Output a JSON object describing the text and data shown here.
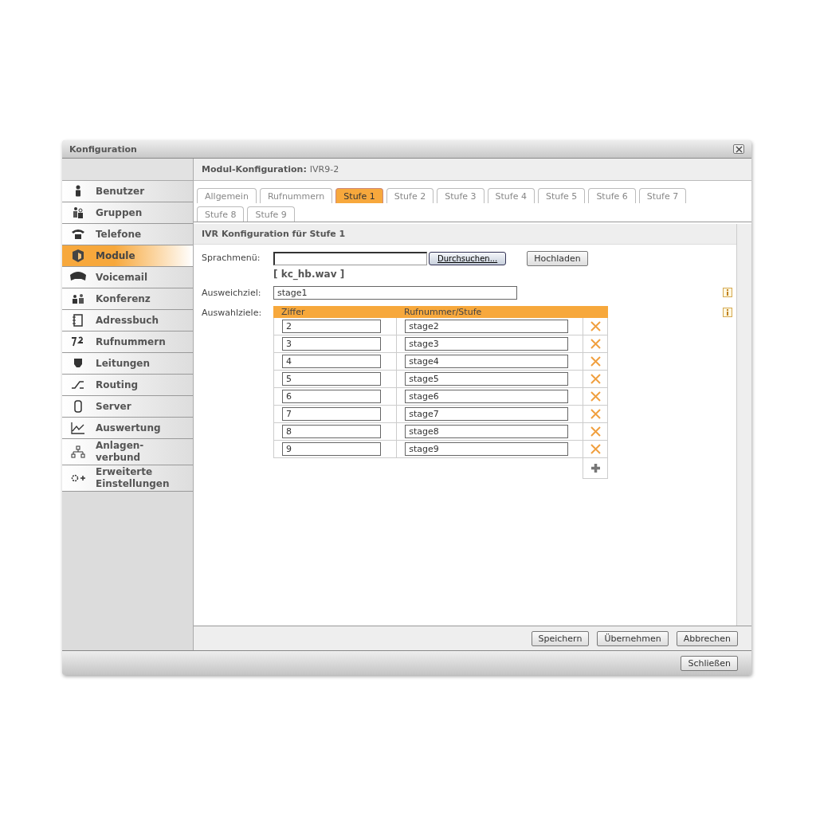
{
  "window": {
    "title": "Konfiguration"
  },
  "sidebar": {
    "items": [
      {
        "label": "Benutzer",
        "selected": false
      },
      {
        "label": "Gruppen",
        "selected": false
      },
      {
        "label": "Telefone",
        "selected": false
      },
      {
        "label": "Module",
        "selected": true
      },
      {
        "label": "Voicemail",
        "selected": false
      },
      {
        "label": "Konferenz",
        "selected": false
      },
      {
        "label": "Adressbuch",
        "selected": false
      },
      {
        "label": "Rufnummern",
        "selected": false
      },
      {
        "label": "Leitungen",
        "selected": false
      },
      {
        "label": "Routing",
        "selected": false
      },
      {
        "label": "Server",
        "selected": false
      },
      {
        "label": "Auswertung",
        "selected": false
      },
      {
        "label": "Anlagen-\nverbund",
        "selected": false
      },
      {
        "label": "Erweiterte\nEinstellungen",
        "selected": false
      }
    ]
  },
  "header": {
    "label": "Modul-Konfiguration:",
    "value": "IVR9-2"
  },
  "tabs": [
    {
      "label": "Allgemein",
      "selected": false
    },
    {
      "label": "Rufnummern",
      "selected": false
    },
    {
      "label": "Stufe 1",
      "selected": true
    },
    {
      "label": "Stufe 2",
      "selected": false
    },
    {
      "label": "Stufe 3",
      "selected": false
    },
    {
      "label": "Stufe 4",
      "selected": false
    },
    {
      "label": "Stufe 5",
      "selected": false
    },
    {
      "label": "Stufe 6",
      "selected": false
    },
    {
      "label": "Stufe 7",
      "selected": false
    },
    {
      "label": "Stufe 8",
      "selected": false
    },
    {
      "label": "Stufe 9",
      "selected": false
    }
  ],
  "section_title": "IVR Konfiguration für Stufe 1",
  "form": {
    "sprachmenu_label": "Sprachmenü:",
    "browse_button": "Durchsuchen...",
    "upload_button": "Hochladen",
    "current_file": "[ kc_hb.wav ]",
    "fallback_label": "Ausweichziel:",
    "fallback_value": "stage1",
    "targets_label": "Auswahlziele:"
  },
  "table": {
    "columns": [
      "Ziffer",
      "Rufnummer/Stufe"
    ],
    "rows": [
      {
        "digit": "2",
        "target": "stage2"
      },
      {
        "digit": "3",
        "target": "stage3"
      },
      {
        "digit": "4",
        "target": "stage4"
      },
      {
        "digit": "5",
        "target": "stage5"
      },
      {
        "digit": "6",
        "target": "stage6"
      },
      {
        "digit": "7",
        "target": "stage7"
      },
      {
        "digit": "8",
        "target": "stage8"
      },
      {
        "digit": "9",
        "target": "stage9"
      }
    ]
  },
  "buttons": [
    "Speichern",
    "Übernehmen",
    "Abbrechen"
  ],
  "close_button": "Schließen"
}
